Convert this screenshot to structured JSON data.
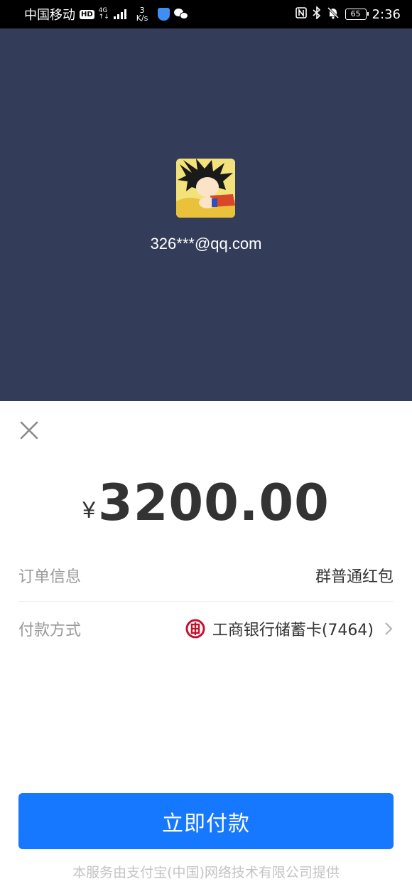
{
  "status_bar": {
    "carrier": "中国移动",
    "hd": "HD",
    "network_top": "4G",
    "network_bottom": "↑↓",
    "speed_value": "3",
    "speed_unit": "K/s",
    "battery": "65",
    "time": "2:36"
  },
  "header": {
    "account": "326***@qq.com",
    "background_color": "#333d5a"
  },
  "payment": {
    "currency_symbol": "¥",
    "amount": "3200.00",
    "order_label": "订单信息",
    "order_value": "群普通红包",
    "method_label": "付款方式",
    "method_value": "工商银行储蓄卡(7464)",
    "bank_icon": "icbc-logo-icon",
    "pay_button": "立即付款",
    "accent_color": "#1677ff"
  },
  "footer": {
    "text": "本服务由支付宝(中国)网络技术有限公司提供"
  }
}
